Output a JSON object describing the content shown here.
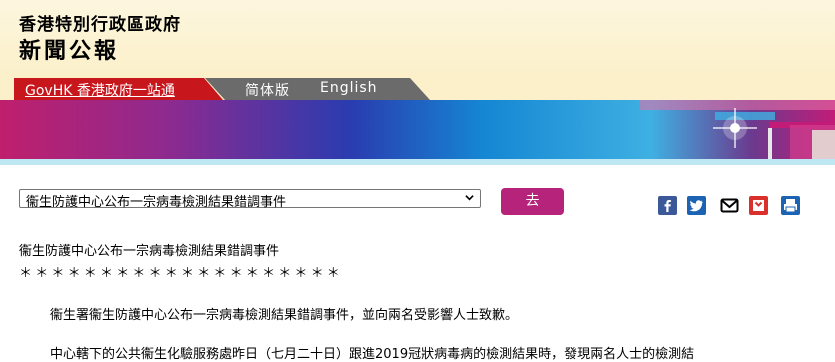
{
  "header": {
    "gov_name": "香港特別行政區政府",
    "press_title": "新聞公報"
  },
  "nav": {
    "govhk_label": "GovHK 香港政府一站通",
    "simplified_label": "简体版",
    "english_label": "English"
  },
  "colors": {
    "govhk_red": "#c8161d",
    "nav_gray": "#6b6b6b",
    "go_button": "#b5237a",
    "header_bg": "#fbf0c9"
  },
  "toolbar": {
    "selected_option": "衞生防護中心公布一宗病毒檢測結果錯調事件",
    "go_label": "去"
  },
  "share_icons": [
    "facebook-icon",
    "twitter-icon",
    "email-icon",
    "bookmark-icon",
    "print-icon"
  ],
  "article": {
    "title": "衞生防護中心公布一宗病毒檢測結果錯調事件",
    "separator": "＊＊＊＊＊＊＊＊＊＊＊＊＊＊＊＊＊＊＊＊",
    "para1": "衞生署衞生防護中心公布一宗病毒檢測結果錯調事件，並向兩名受影響人士致歉。",
    "para2": "中心轄下的公共衞生化驗服務處昨日（七月二十日）跟進2019冠狀病毒病的檢測結果時，發現兩名人士的檢測結"
  }
}
